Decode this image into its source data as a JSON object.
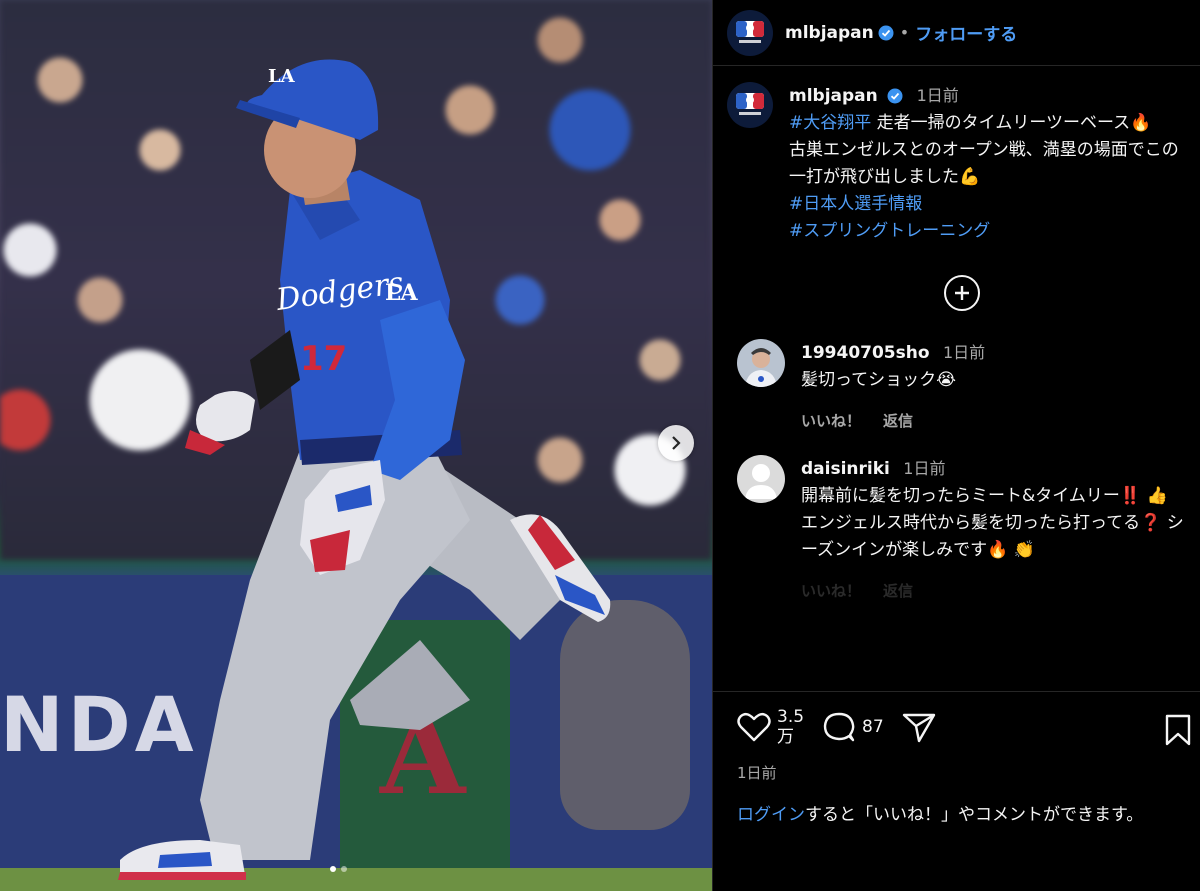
{
  "header": {
    "username": "mlbjapan",
    "separator": "•",
    "follow_label": "フォローする"
  },
  "caption": {
    "username": "mlbjapan",
    "time": "1日前",
    "line1_tag": "#大谷翔平",
    "line1_text": " 走者一掃のタイムリーツーベース🔥",
    "line2": "古巣エンゼルスとのオープン戦、満塁の場面でこの一打が飛び出しました💪",
    "tag2": "#日本人選手情報",
    "tag3": "#スプリングトレーニング"
  },
  "comments": [
    {
      "username": "19940705sho",
      "time": "1日前",
      "text": "髪切ってショック😭",
      "like": "いいね！",
      "reply": "返信"
    },
    {
      "username": "daisinriki",
      "time": "1日前",
      "text": "開幕前に髪を切ったらミート&タイムリー‼️ 👍 エンジェルス時代から髪を切ったら打ってる❓ シーズンインが楽しみです🔥 👏",
      "like": "いいね！",
      "reply": "返信"
    }
  ],
  "actions": {
    "likes": "3.5\n万",
    "likes_line1": "3.5",
    "likes_line2": "万",
    "comments_count": "87",
    "date": "1日前"
  },
  "login": {
    "link": "ログイン",
    "text": "すると「いいね！」やコメントができます。"
  },
  "media": {
    "wall_text": "NDA",
    "wall_letter": "A",
    "jersey_script": "Dodgers",
    "jersey_number": "17",
    "helmet_logo": "LA",
    "sleeve_logo": "LA",
    "carousel_total": 2,
    "carousel_active": 1
  },
  "colors": {
    "link_blue": "#4f9cf5",
    "dodger_blue": "#2a56c6",
    "background": "#000000"
  }
}
